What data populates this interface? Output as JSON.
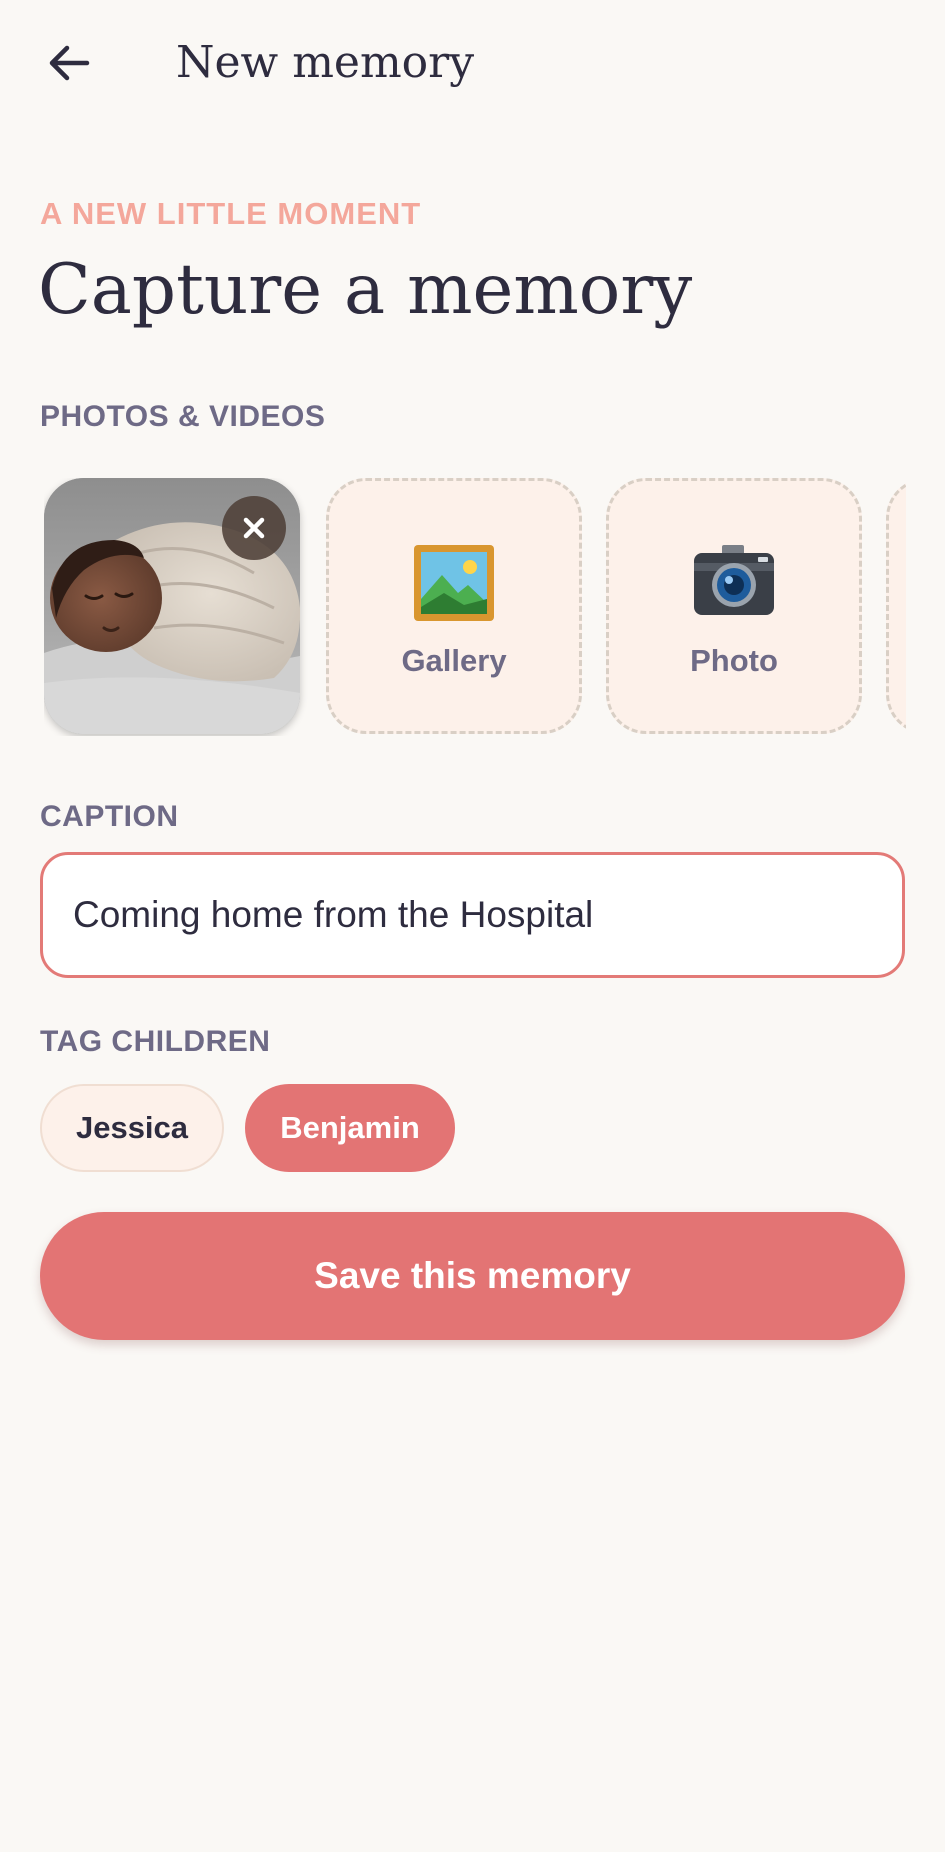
{
  "header": {
    "back_icon": "arrow-left-icon",
    "title": "New memory"
  },
  "intro": {
    "eyebrow": "A NEW LITTLE MOMENT",
    "headline": "Capture a memory"
  },
  "media": {
    "section_label": "PHOTOS & VIDEOS",
    "attached": [
      {
        "kind": "photo",
        "subject": "swaddled sleeping baby",
        "remove_icon": "close-icon"
      }
    ],
    "sources": [
      {
        "label": "Gallery",
        "icon": "framed-picture-icon"
      },
      {
        "label": "Photo",
        "icon": "camera-icon"
      }
    ]
  },
  "caption": {
    "section_label": "CAPTION",
    "value": "Coming home from the Hospital"
  },
  "tags": {
    "section_label": "TAG CHILDREN",
    "children": [
      {
        "name": "Jessica",
        "selected": false
      },
      {
        "name": "Benjamin",
        "selected": true
      }
    ]
  },
  "actions": {
    "save_label": "Save this memory"
  },
  "colors": {
    "background": "#FAF8F5",
    "accent": "#E37474",
    "eyebrow": "#F4A79B",
    "label": "#6E6A86",
    "text": "#2E2C3F",
    "tile_bg": "#FDF1EA"
  }
}
